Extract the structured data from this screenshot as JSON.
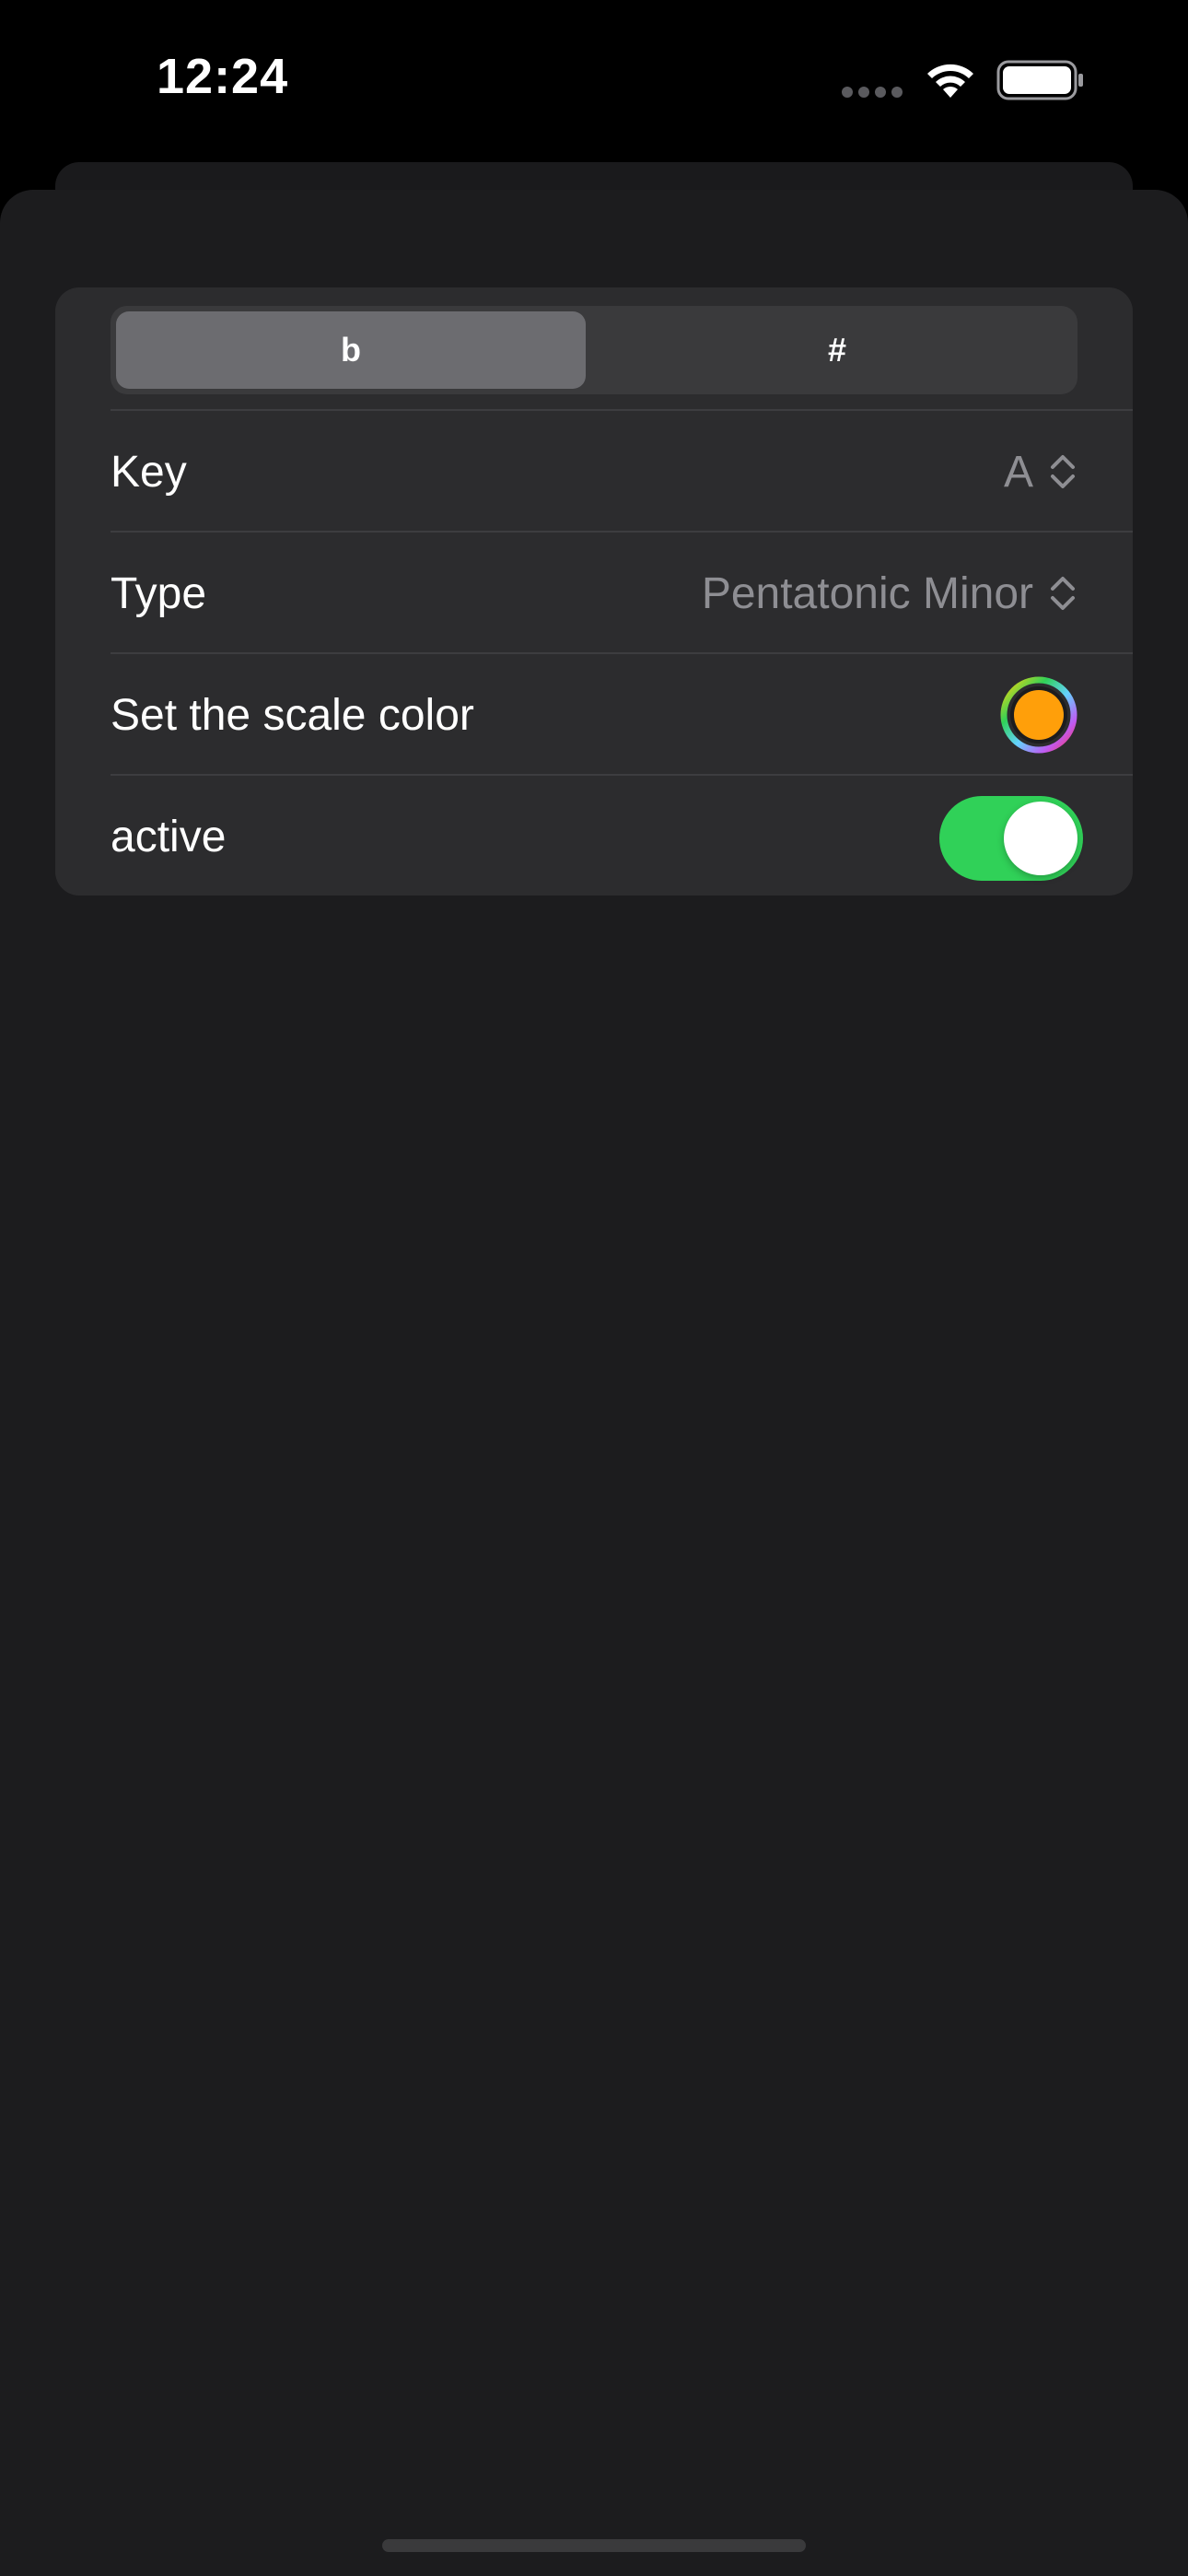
{
  "status_bar": {
    "time": "12:24"
  },
  "segmented_control": {
    "segments": [
      {
        "label": "b",
        "selected": true
      },
      {
        "label": "#",
        "selected": false
      }
    ]
  },
  "rows": {
    "key": {
      "label": "Key",
      "value": "A"
    },
    "type": {
      "label": "Type",
      "value": "Pentatonic Minor"
    },
    "color": {
      "label": "Set the scale color",
      "swatch": "#ff9f0a"
    },
    "active": {
      "label": "active",
      "on": true
    }
  },
  "colors": {
    "background": "#1c1c1e",
    "card": "#2c2c2e",
    "toggle_on": "#30d158",
    "selected_segment": "#6c6c70"
  },
  "icons": [
    "wifi-icon",
    "battery-icon",
    "chevron-updown-icon",
    "color-picker-icon"
  ]
}
